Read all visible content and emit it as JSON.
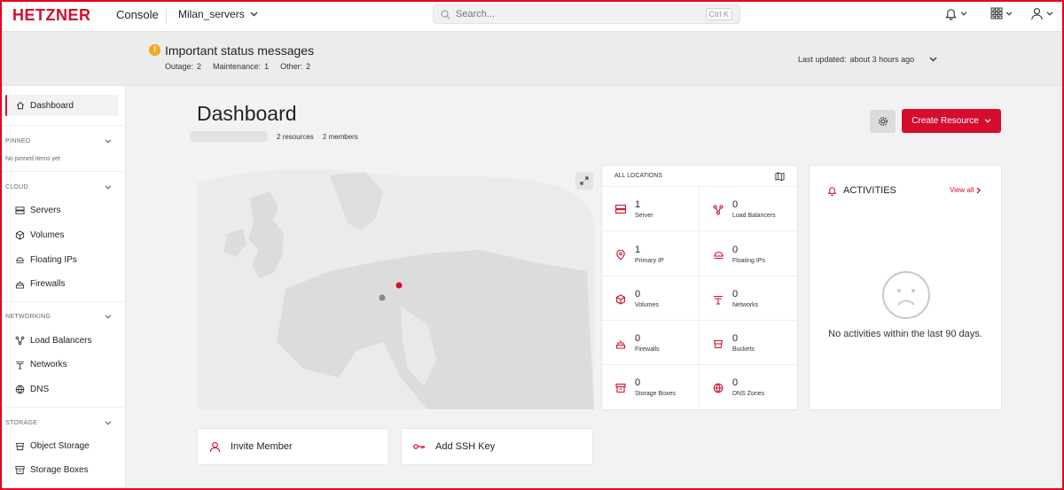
{
  "topbar": {
    "logo": "HETZNER",
    "console_label": "Console",
    "project": "Milan_servers",
    "search_placeholder": "Search...",
    "search_shortcut": "Ctrl K"
  },
  "status": {
    "title": "Important status messages",
    "outage_label": "Outage:",
    "outage_count": "2",
    "maintenance_label": "Maintenance:",
    "maintenance_count": "1",
    "other_label": "Other:",
    "other_count": "2",
    "last_updated_label": "Last updated:",
    "last_updated_value": "about 3 hours ago"
  },
  "sidebar": {
    "dashboard": "Dashboard",
    "pinned_section": "PINNED",
    "pinned_empty": "No pinned items yet",
    "cloud_section": "CLOUD",
    "cloud_items": [
      "Servers",
      "Volumes",
      "Floating IPs",
      "Firewalls"
    ],
    "networking_section": "NETWORKING",
    "networking_items": [
      "Load Balancers",
      "Networks",
      "DNS"
    ],
    "storage_section": "STORAGE",
    "storage_items": [
      "Object Storage",
      "Storage Boxes"
    ]
  },
  "main": {
    "title": "Dashboard",
    "resources": "2 resources",
    "members": "2 members",
    "create_button": "Create Resource"
  },
  "locations": {
    "header": "ALL LOCATIONS",
    "resources": [
      {
        "count": "1",
        "label": "Server",
        "icon": "server-icon"
      },
      {
        "count": "0",
        "label": "Load Balancers",
        "icon": "load-balancer-icon"
      },
      {
        "count": "1",
        "label": "Primary IP",
        "icon": "primary-ip-icon"
      },
      {
        "count": "0",
        "label": "Floating IPs",
        "icon": "floating-ip-icon"
      },
      {
        "count": "0",
        "label": "Volumes",
        "icon": "volume-icon"
      },
      {
        "count": "0",
        "label": "Networks",
        "icon": "network-icon"
      },
      {
        "count": "0",
        "label": "Firewalls",
        "icon": "firewall-icon"
      },
      {
        "count": "0",
        "label": "Buckets",
        "icon": "bucket-icon"
      },
      {
        "count": "0",
        "label": "Storage Boxes",
        "icon": "storage-box-icon"
      },
      {
        "count": "0",
        "label": "DNS Zones",
        "icon": "dns-icon"
      }
    ]
  },
  "activities": {
    "title": "ACTIVITIES",
    "view_all": "View all",
    "empty": "No activities within the last 90 days."
  },
  "actions": {
    "invite": "Invite Member",
    "ssh": "Add SSH Key"
  },
  "colors": {
    "brand_red": "#d50c2d",
    "warning": "#f2a81d"
  }
}
